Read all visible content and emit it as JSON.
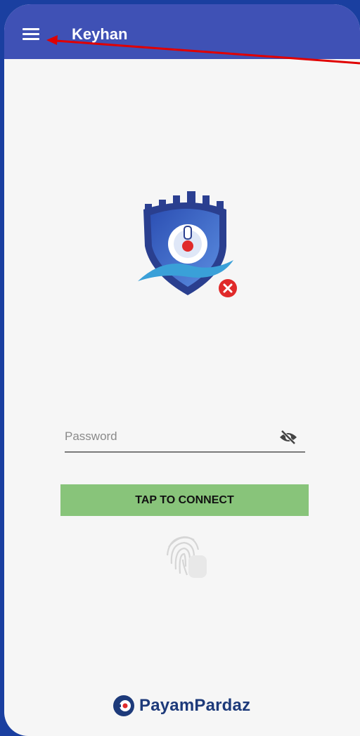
{
  "app_bar": {
    "title": "Keyhan",
    "menu_icon": "menu-icon"
  },
  "logo": {
    "icon": "shield-logo-icon",
    "status_badge": "error-x-icon"
  },
  "password": {
    "placeholder": "Password",
    "value": "",
    "toggle_icon": "visibility-off-icon"
  },
  "connect_button": {
    "label": "TAP TO CONNECT"
  },
  "fingerprint": {
    "icon": "fingerprint-icon"
  },
  "footer": {
    "brand": "PayamPardaz"
  },
  "colors": {
    "app_bar": "#3f51b5",
    "button": "#88c47a",
    "background": "#f6f6f6",
    "arrow": "#e00000",
    "brand": "#1d3a7a"
  }
}
